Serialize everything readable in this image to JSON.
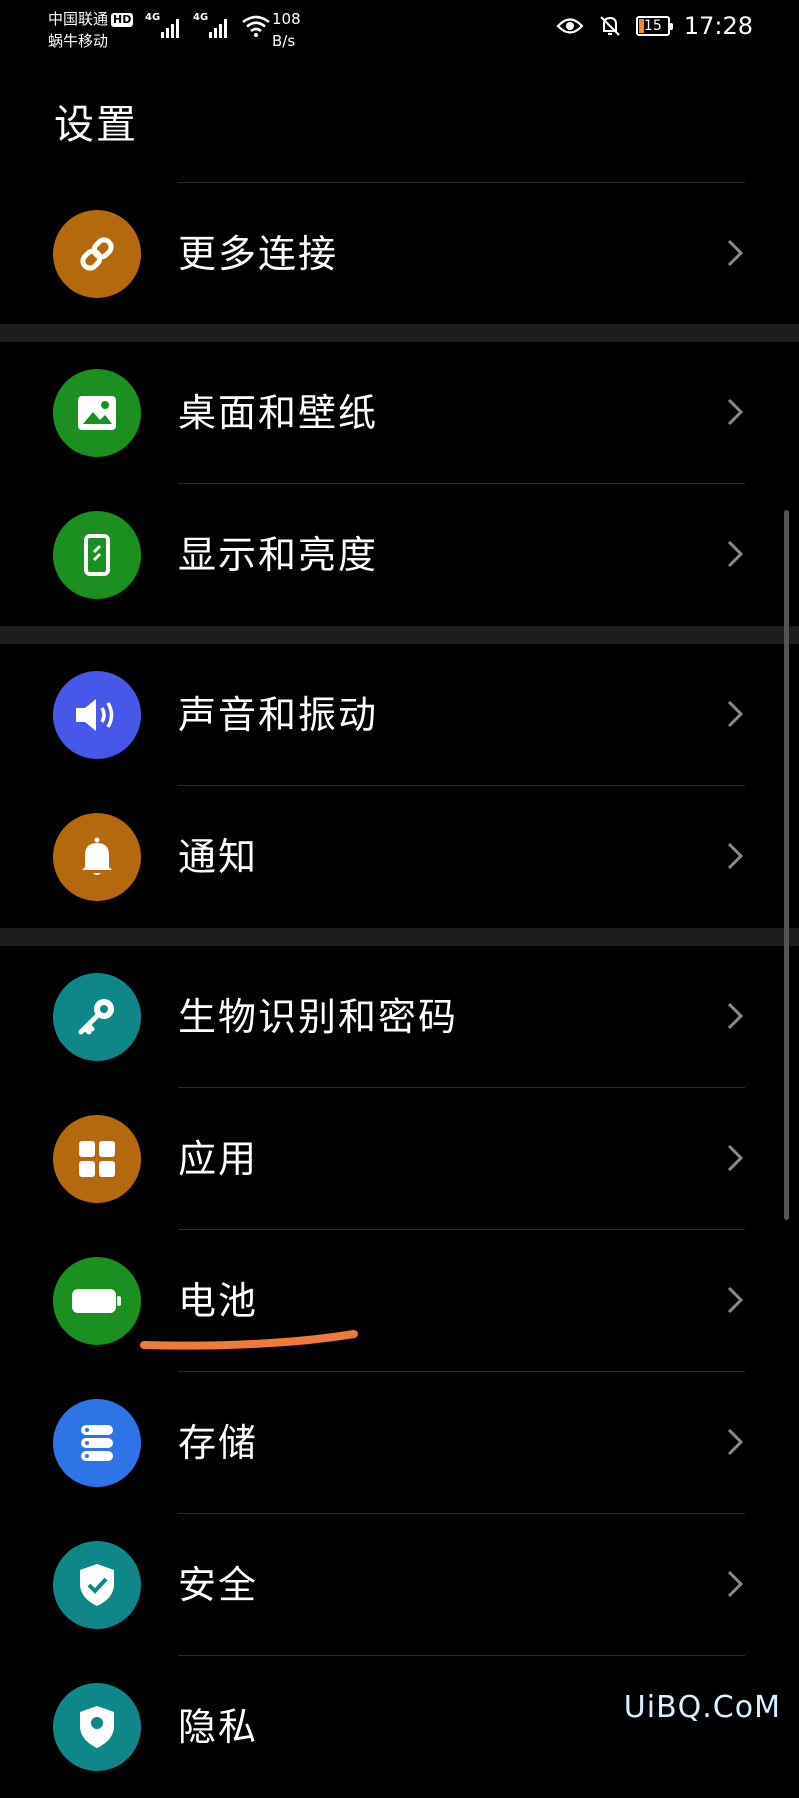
{
  "status_bar": {
    "carrier_1": "中国联通",
    "carrier_1_badge": "HD",
    "carrier_2": "蜗牛移动",
    "signal_1_label": "4G",
    "signal_2_label": "4G",
    "net_speed_value": "108",
    "net_speed_unit": "B/s",
    "battery_level": "15",
    "time": "17:28"
  },
  "title": "设置",
  "settings": [
    {
      "label": "更多连接",
      "icon": "link-icon",
      "color": "#b5690f"
    },
    {
      "label": "桌面和壁纸",
      "icon": "image-icon",
      "color": "#1b8f20"
    },
    {
      "label": "显示和亮度",
      "icon": "phone-display-icon",
      "color": "#1b8f20"
    },
    {
      "label": "声音和振动",
      "icon": "speaker-icon",
      "color": "#4758e8"
    },
    {
      "label": "通知",
      "icon": "bell-icon",
      "color": "#b5690f"
    },
    {
      "label": "生物识别和密码",
      "icon": "key-icon",
      "color": "#0f8688"
    },
    {
      "label": "应用",
      "icon": "apps-grid-icon",
      "color": "#b5690f"
    },
    {
      "label": "电池",
      "icon": "battery-icon",
      "color": "#1b8f20"
    },
    {
      "label": "存储",
      "icon": "storage-icon",
      "color": "#2f74e6"
    },
    {
      "label": "安全",
      "icon": "shield-check-icon",
      "color": "#0f8688"
    },
    {
      "label": "隐私",
      "icon": "privacy-icon",
      "color": "#0f8688"
    }
  ],
  "annotation_color": "#f07a3a",
  "watermark": "UiBQ.CoM"
}
